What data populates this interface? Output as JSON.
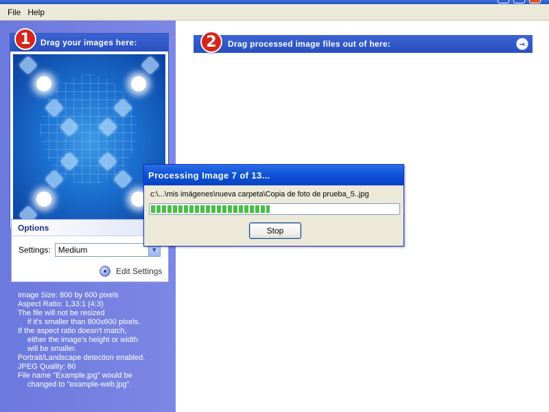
{
  "menu": {
    "items": [
      "File",
      "Help"
    ]
  },
  "left_panel": {
    "drop_title": "Drag your images here:",
    "drop_step": "1",
    "options": {
      "title": "Options",
      "settings_label": "Settings:",
      "settings_value": "Medium",
      "edit_settings_label": "Edit Settings"
    },
    "info_lines": [
      "Image Size: 800 by 600 pixels",
      "Aspect Ratio: 1,33:1 (4:3)",
      "The file will not be resized",
      "if it's smaller than 800x600 pixels.",
      "If the aspect ratio doesn't match,",
      "either the image's height or width",
      "will be smaller.",
      "Portrait/Landscape detection enabled.",
      "JPEG Quality: 80",
      "File name \"Example.jpg\" would be",
      "changed to \"example-web.jpg\"."
    ]
  },
  "right_panel": {
    "title": "Drag processed image files out of here:",
    "step": "2"
  },
  "dialog": {
    "title": "Processing Image 7 of 13...",
    "path": "c:\\...\\mis imágenes\\nueva carpeta\\Copia de foto de prueba_5..jpg",
    "progress_fraction": 0.48,
    "stop_label": "Stop"
  },
  "colors": {
    "header_blue": "#2a4fbf",
    "panel_purple": "#7d87e4",
    "badge_red": "#d6251d",
    "progress_green": "#45c047"
  }
}
